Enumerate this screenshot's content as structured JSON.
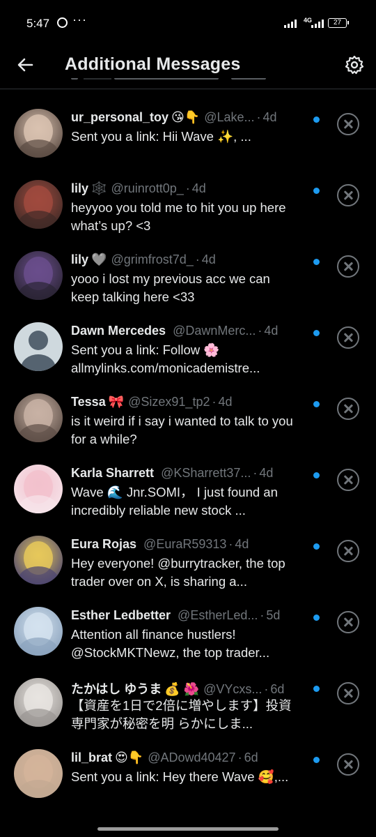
{
  "status_bar": {
    "time": "5:47",
    "network": "4G",
    "battery": "27",
    "icons": [
      "whatsapp-icon",
      "more-dots-icon",
      "signal-icon",
      "battery-icon"
    ]
  },
  "header": {
    "title": "Additional Messages",
    "back_icon": "arrow-left-icon",
    "settings_icon": "gear-icon"
  },
  "colors": {
    "background": "#000000",
    "text": "#e7e9ea",
    "muted": "#71767b",
    "unread_dot": "#1d9bf0",
    "divider": "#2f3336"
  },
  "messages": [
    {
      "name": "ur_personal_toy",
      "emoji": "😘👇",
      "handle": "@Lake...",
      "age": "4d",
      "preview": "Sent you a link: Hii Wave ✨, ...",
      "unread": true,
      "avatar": [
        "#d9c2b0",
        "#5a4a42"
      ]
    },
    {
      "name": "lily",
      "emoji": "🕸️",
      "handle": "@ruinrott0p_",
      "age": "4d",
      "preview": "heyyoo you told me to hit you up here what’s up? <3",
      "unread": true,
      "avatar": [
        "#a04a3e",
        "#3e2a26"
      ]
    },
    {
      "name": "lily",
      "emoji": "🩶",
      "handle": "@grimfrost7d_",
      "age": "4d",
      "preview": "yooo i lost my previous acc we can keep talking here <33",
      "unread": true,
      "avatar": [
        "#6a4e8c",
        "#2a2433"
      ]
    },
    {
      "name": "Dawn Mercedes",
      "emoji": "",
      "handle": "@DawnMerc...",
      "age": "4d",
      "preview": "Sent you a link: Follow 🌸 allmylinks.com/monicademistre...",
      "unread": true,
      "avatar": [
        "#556370",
        "#556370"
      ],
      "default_avatar": true
    },
    {
      "name": "Tessa",
      "emoji": "🎀",
      "handle": "@Sizex91_tp2",
      "age": "4d",
      "preview": "is it weird if i say i wanted to talk to you for a while?",
      "unread": true,
      "avatar": [
        "#c8b2a4",
        "#5c4d46"
      ]
    },
    {
      "name": "Karla Sharrett",
      "emoji": "",
      "handle": "@KSharrett37...",
      "age": "4d",
      "preview": "Wave 🌊 Jnr.SOMI， I just found an incredibly reliable new stock ...",
      "unread": true,
      "avatar": [
        "#f2c1cd",
        "#f6e4ea"
      ]
    },
    {
      "name": "Eura Rojas",
      "emoji": "",
      "handle": "@EuraR59313",
      "age": "4d",
      "preview": "Hey everyone! @burrytracker, the top trader over on X, is sharing a...",
      "unread": true,
      "avatar": [
        "#e6c85a",
        "#4b4470"
      ]
    },
    {
      "name": "Esther Ledbetter",
      "emoji": "",
      "handle": "@EstherLed...",
      "age": "5d",
      "preview": "Attention all finance hustlers! @StockMKTNewz, the top trader...",
      "unread": true,
      "avatar": [
        "#d4e2ee",
        "#8aa2bd"
      ]
    },
    {
      "name": "たかはし ゆうま",
      "emoji": "💰 🌺",
      "handle": "@VYcxs...",
      "age": "6d",
      "preview": "【資産を1日で2倍に増やします】投資専門家が秘密を明 らかにしま...",
      "unread": true,
      "avatar": [
        "#e8e4e0",
        "#9a9693"
      ]
    },
    {
      "name": "lil_brat",
      "emoji": "😍👇",
      "handle": "@ADowd40427",
      "age": "6d",
      "preview": "Sent you a link: Hey there Wave 🥰,...",
      "unread": true,
      "avatar": [
        "#d4b49a",
        "#c2a892"
      ]
    }
  ]
}
